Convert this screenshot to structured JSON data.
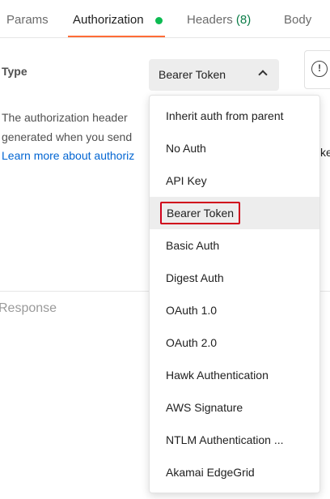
{
  "tabs": [
    {
      "label": "Params"
    },
    {
      "label": "Authorization"
    },
    {
      "label": "Headers ",
      "count": "(8)"
    },
    {
      "label": "Body"
    }
  ],
  "auth": {
    "type_label": "Type",
    "selected_type": "Bearer Token",
    "description_line1": "The authorization header",
    "description_line2": "generated when you send",
    "learn_more": "Learn more about authoriz",
    "right_partial_text": "ke"
  },
  "response": {
    "label": "Response"
  },
  "dropdown": {
    "options": [
      {
        "label": "Inherit auth from parent"
      },
      {
        "label": "No Auth"
      },
      {
        "label": "API Key"
      },
      {
        "label": "Bearer Token"
      },
      {
        "label": "Basic Auth"
      },
      {
        "label": "Digest Auth"
      },
      {
        "label": "OAuth 1.0"
      },
      {
        "label": "OAuth 2.0"
      },
      {
        "label": "Hawk Authentication"
      },
      {
        "label": "AWS Signature"
      },
      {
        "label": "NTLM Authentication ..."
      },
      {
        "label": "Akamai EdgeGrid"
      }
    ]
  },
  "colors": {
    "accent": "#ff6c37",
    "status_dot": "#0cbb52",
    "link": "#0265d2",
    "highlight_box": "#d0021b"
  },
  "icons": {
    "chevron": "chevron-up-icon",
    "info": "info-icon",
    "status": "status-dot-icon"
  }
}
